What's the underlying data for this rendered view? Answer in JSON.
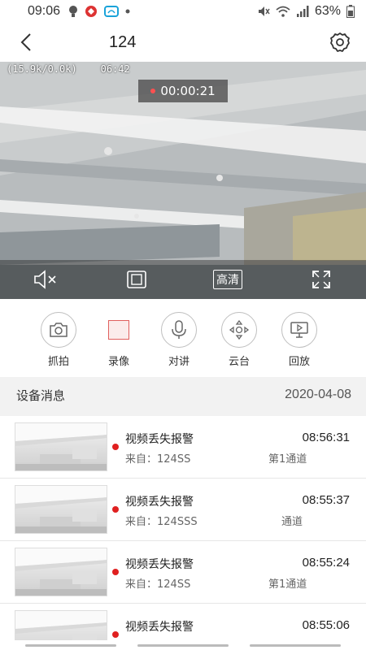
{
  "status": {
    "time": "09:06",
    "battery": "63%",
    "left_icons": [
      "bulb-icon",
      "app-badge-icon",
      "cloud-app-icon",
      "dot-icon"
    ],
    "right_icons": [
      "mute-icon",
      "wifi-icon",
      "signal-icon",
      "battery-icon"
    ]
  },
  "nav": {
    "title": "124"
  },
  "video": {
    "bitrate": "(15.9k/0.0k)",
    "clock_fragment": "06:42",
    "recording_time": "00:00:21",
    "quality": "高清"
  },
  "actions": [
    {
      "label": "抓拍",
      "icon": "camera-icon"
    },
    {
      "label": "录像",
      "icon": "record-icon"
    },
    {
      "label": "对讲",
      "icon": "microphone-icon"
    },
    {
      "label": "云台",
      "icon": "ptz-icon"
    },
    {
      "label": "回放",
      "icon": "playback-icon"
    }
  ],
  "messages_header": {
    "title": "设备消息",
    "date": "2020-04-08"
  },
  "messages": [
    {
      "title": "视频丢失报警",
      "time": "08:56:31",
      "from": "来自：124SS",
      "channel": "第1通道"
    },
    {
      "title": "视频丢失报警",
      "time": "08:55:37",
      "from": "来自：124SSS",
      "channel": "通道"
    },
    {
      "title": "视频丢失报警",
      "time": "08:55:24",
      "from": "来自：124SS",
      "channel": "第1通道"
    },
    {
      "title": "视频丢失报警",
      "time": "08:55:06",
      "from": "",
      "channel": ""
    }
  ],
  "colors": {
    "accent_red": "#e02020",
    "record_red": "#e0605e"
  }
}
